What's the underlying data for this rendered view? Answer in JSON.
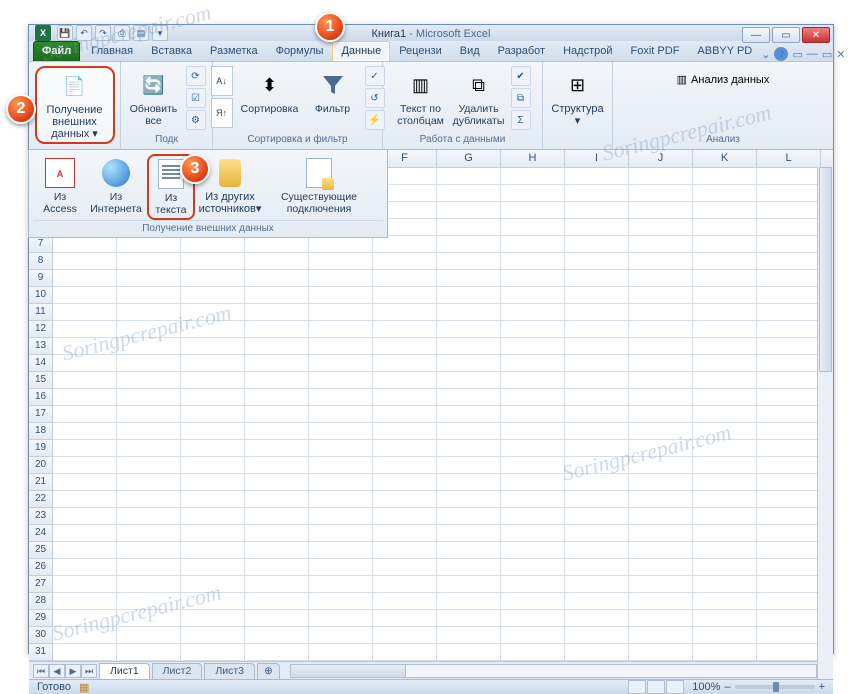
{
  "window": {
    "doc_name": "Книга1",
    "app_name": "Microsoft Excel",
    "separator": "  -  "
  },
  "qat": {
    "save": "💾",
    "undo": "↶",
    "redo": "↷",
    "extra1": "⎙",
    "extra2": "▤",
    "dd": "▾"
  },
  "winctrl": {
    "min": "—",
    "max": "▭",
    "close": "✕"
  },
  "tabs": {
    "file": "Файл",
    "items": [
      "Главная",
      "Вставка",
      "Разметка",
      "Формулы",
      "Данные",
      "Рецензи",
      "Вид",
      "Разработ",
      "Надстрой",
      "Foxit PDF",
      "ABBYY PD"
    ],
    "active_index": 4,
    "right": {
      "chev": "⌄",
      "help": "?",
      "minrib": "▭",
      "doc_min": "—",
      "doc_max": "▭",
      "doc_close": "✕"
    }
  },
  "ribbon": {
    "groups": {
      "external": {
        "label": "Получение\nвнешних данных",
        "drop_arrow": "▾"
      },
      "connections": {
        "refresh": "Обновить\nвсе",
        "c1": "⟳",
        "c2": "☑",
        "c3": "⚙"
      },
      "sort_filter": {
        "glabel": "Сортировка и фильтр",
        "az_top": "А↓",
        "az_bot": "Я↑",
        "sort": "Сортировка",
        "filter": "Фильтр",
        "s1": "✓",
        "s2": "↺",
        "s3": "⚡"
      },
      "data_tools": {
        "glabel": "Работа с данными",
        "text_cols": "Текст по\nстолбцам",
        "remove_dup": "Удалить\nдубликаты",
        "d1": "✔",
        "d2": "⧉",
        "d3": "Σ"
      },
      "outline": {
        "structure": "Структура",
        "arrow": "▾"
      },
      "analysis": {
        "glabel": "Анализ",
        "btn": "Анализ данных",
        "icon": "▥"
      }
    },
    "dropdown": {
      "glabel": "Получение внешних данных",
      "items": [
        {
          "label": "Из\nAccess"
        },
        {
          "label": "Из\nИнтернета"
        },
        {
          "label": "Из\nтекста"
        },
        {
          "label": "Из других\nисточников",
          "dd": "▾"
        },
        {
          "label": "Существующие\nподключения"
        }
      ]
    }
  },
  "sheet": {
    "cols": [
      "",
      "",
      "",
      "",
      "",
      "F",
      "G",
      "H",
      "I",
      "J",
      "K",
      "L"
    ],
    "first_row": 3,
    "row_count": 29
  },
  "sheet_tabs": {
    "nav": [
      "⏮",
      "◀",
      "▶",
      "⏭"
    ],
    "tabs": [
      "Лист1",
      "Лист2",
      "Лист3"
    ],
    "add": "⊕"
  },
  "status": {
    "ready": "Готово",
    "macro_icon": "▦",
    "zoom_pct": "100%",
    "minus": "–",
    "plus": "+"
  },
  "callouts": {
    "c1": "1",
    "c2": "2",
    "c3": "3"
  },
  "watermark": "Soringpcrepair.com"
}
